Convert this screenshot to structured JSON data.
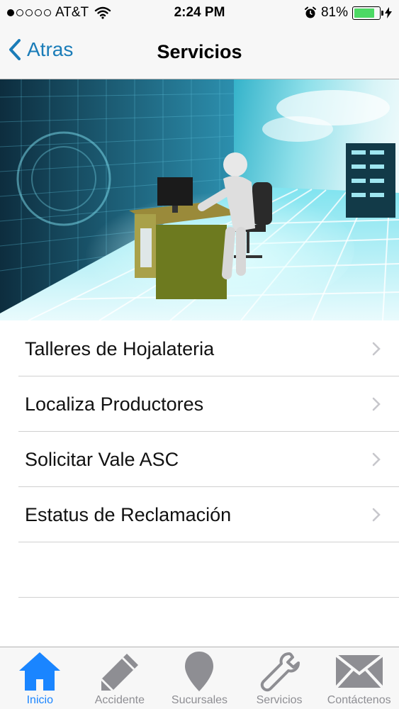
{
  "status_bar": {
    "carrier": "AT&T",
    "time": "2:24 PM",
    "battery_percent": "81%",
    "battery_level": 0.81,
    "signal_bars": 1,
    "icons": [
      "signal-dots-icon",
      "wifi-icon",
      "alarm-icon",
      "battery-icon",
      "charging-bolt-icon"
    ]
  },
  "nav": {
    "back_label": "Atras",
    "title": "Servicios"
  },
  "hero": {
    "icon": "hero-image-businessman-at-computer"
  },
  "list": {
    "items": [
      {
        "label": "Talleres de Hojalateria"
      },
      {
        "label": "Localiza Productores"
      },
      {
        "label": "Solicitar Vale ASC"
      },
      {
        "label": "Estatus de Reclamación"
      }
    ]
  },
  "tab_bar": {
    "tabs": [
      {
        "label": "Inicio",
        "icon": "home-icon",
        "active": true
      },
      {
        "label": "Accidente",
        "icon": "pencil-icon",
        "active": false
      },
      {
        "label": "Sucursales",
        "icon": "map-pin-icon",
        "active": false
      },
      {
        "label": "Servicios",
        "icon": "wrench-icon",
        "active": false
      },
      {
        "label": "Contáctenos",
        "icon": "envelope-icon",
        "active": false
      }
    ]
  },
  "colors": {
    "accent": "#1a7cb8",
    "tab_active": "#1a85ff",
    "tab_inactive": "#8e8e93",
    "battery": "#4cd964"
  }
}
